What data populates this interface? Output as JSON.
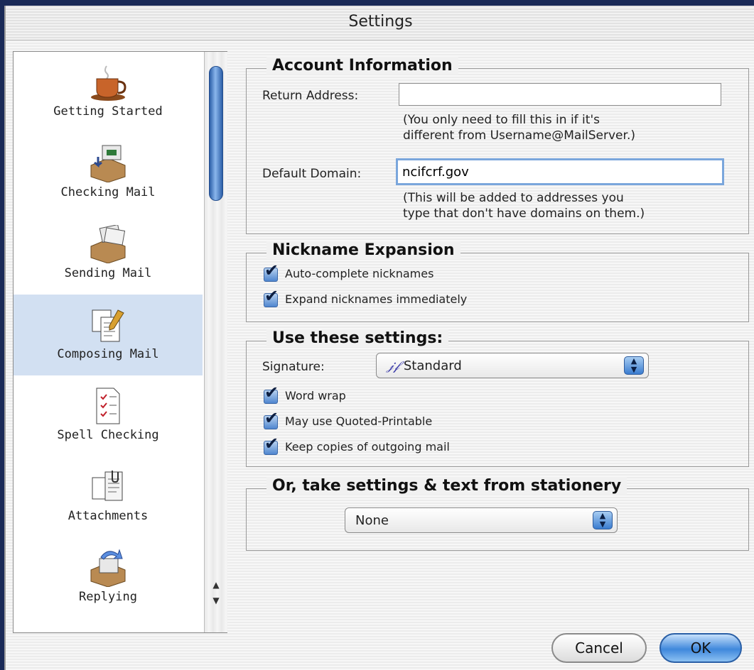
{
  "window": {
    "title": "Settings"
  },
  "sidebar": {
    "items": [
      {
        "label": "Getting Started",
        "icon": "coffee-cup-icon",
        "selected": false
      },
      {
        "label": "Checking Mail",
        "icon": "checking-mail-icon",
        "selected": false
      },
      {
        "label": "Sending Mail",
        "icon": "sending-mail-icon",
        "selected": false
      },
      {
        "label": "Composing Mail",
        "icon": "composing-mail-icon",
        "selected": true
      },
      {
        "label": "Spell Checking",
        "icon": "spell-checking-icon",
        "selected": false
      },
      {
        "label": "Attachments",
        "icon": "attachments-icon",
        "selected": false
      },
      {
        "label": "Replying",
        "icon": "replying-icon",
        "selected": false
      }
    ]
  },
  "account": {
    "title": "Account Information",
    "return_address_label": "Return Address:",
    "return_address_value": "",
    "return_hint_1": "(You only need to fill this in if it's",
    "return_hint_2": "different from Username@MailServer.)",
    "domain_label": "Default Domain:",
    "domain_value": "ncifcrf.gov",
    "domain_hint_1": "(This will be added to addresses you",
    "domain_hint_2": "type that don't have domains on them.)"
  },
  "nickname": {
    "title": "Nickname Expansion",
    "auto_complete": {
      "label": "Auto-complete nicknames",
      "checked": true
    },
    "expand_immediately": {
      "label": "Expand nicknames immediately",
      "checked": true
    }
  },
  "settings": {
    "title": "Use these settings:",
    "signature_label": "Signature:",
    "signature_icon": "𝒿𝒻",
    "signature_value": "Standard",
    "word_wrap": {
      "label": "Word wrap",
      "checked": true
    },
    "quoted_printable": {
      "label": "May use Quoted-Printable",
      "checked": true
    },
    "keep_copies": {
      "label": "Keep copies of outgoing mail",
      "checked": true
    }
  },
  "stationery": {
    "title": "Or, take settings & text from stationery",
    "value": "None"
  },
  "buttons": {
    "cancel": "Cancel",
    "ok": "OK"
  },
  "colors": {
    "selection": "#d2e0f2",
    "accent": "#3f88dc"
  }
}
